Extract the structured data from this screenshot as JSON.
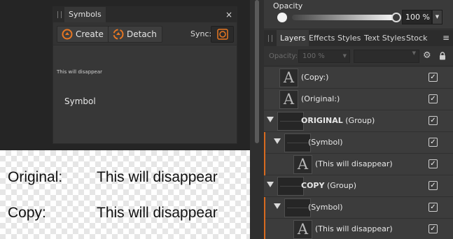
{
  "canvas": {
    "line1_label": "Original:",
    "line1_text": "This will disappear",
    "line2_label": "Copy:",
    "line2_text": "This will disappear"
  },
  "symbols_panel": {
    "tab_label": "Symbols",
    "close_glyph": "×",
    "create_label": "Create",
    "detach_label": "Detach",
    "sync_label": "Sync:",
    "item_small_text": "This will disappear",
    "item_name": "Symbol",
    "accent_color": "#e87722"
  },
  "opacity": {
    "title": "Opacity",
    "value_text": "100 %",
    "value": 1.0
  },
  "tabs": {
    "items": [
      "Layers",
      "Effects",
      "Styles",
      "Text Styles",
      "Stock"
    ],
    "active": "Layers",
    "menu_glyph": "≡"
  },
  "layer_toolbar": {
    "opacity_label": "Opacity:",
    "opacity_value": "100 %",
    "blend_value": ""
  },
  "layers": [
    {
      "name": "(Copy:)",
      "suffix": "",
      "bold": false,
      "kind": "text",
      "checked": true
    },
    {
      "name": "(Original:)",
      "suffix": "",
      "bold": false,
      "kind": "text",
      "checked": true
    },
    {
      "name": "ORIGINAL",
      "suffix": " (Group)",
      "bold": true,
      "kind": "group",
      "checked": true
    },
    {
      "name": "(Symbol)",
      "suffix": "",
      "bold": false,
      "kind": "symbol",
      "checked": true
    },
    {
      "name": "(This will disappear)",
      "suffix": "",
      "bold": false,
      "kind": "text",
      "checked": true
    },
    {
      "name": "COPY",
      "suffix": " (Group)",
      "bold": true,
      "kind": "group",
      "checked": true
    },
    {
      "name": "(Symbol)",
      "suffix": "",
      "bold": false,
      "kind": "symbol",
      "checked": true
    },
    {
      "name": "(This will disappear)",
      "suffix": "",
      "bold": false,
      "kind": "text",
      "checked": true
    }
  ],
  "icons": {
    "thumb_glyph": "A",
    "check_glyph": "✓",
    "gear_glyph": "⚙",
    "dropdown_glyph": "▼"
  }
}
